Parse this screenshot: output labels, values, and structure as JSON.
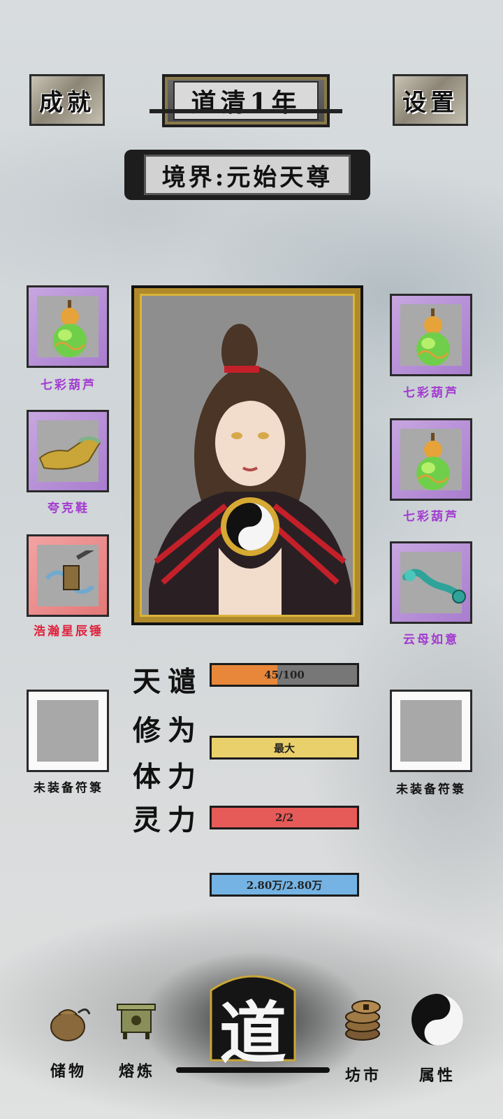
{
  "header": {
    "achievement_label": "成就",
    "settings_label": "设置",
    "year_title": "道清1年",
    "realm_label": "境界:元始天尊"
  },
  "equipment_left": [
    {
      "name": "七彩葫芦",
      "rarity_color": "#a23ad0"
    },
    {
      "name": "夸克鞋",
      "rarity_color": "#a23ad0"
    },
    {
      "name": "浩瀚星辰锤",
      "rarity_color": "#e0213b"
    }
  ],
  "equipment_right": [
    {
      "name": "七彩葫芦",
      "rarity_color": "#a23ad0"
    },
    {
      "name": "七彩葫芦",
      "rarity_color": "#a23ad0"
    },
    {
      "name": "云母如意",
      "rarity_color": "#a23ad0"
    }
  ],
  "talisman_slots": {
    "left": "未装备符箓",
    "right": "未装备符箓"
  },
  "stats": [
    {
      "label": "天谴",
      "value_text": "45/100",
      "fill": 0.45,
      "color": "#e8873a"
    },
    {
      "label": "修为",
      "value_text": "最大",
      "fill": 1.0,
      "color": "#e9d06a"
    },
    {
      "label": "体力",
      "value_text": "2/2",
      "fill": 1.0,
      "color": "#e65a57"
    },
    {
      "label": "灵力",
      "value_text": "2.80万/2.80万",
      "fill": 1.0,
      "color": "#74b3e3"
    }
  ],
  "bottom_nav": {
    "storage": "储物",
    "refine": "熔炼",
    "center": "道",
    "market": "坊市",
    "attributes": "属性"
  },
  "icons": {
    "gourd": "gourd-icon",
    "shoe": "shoe-icon",
    "hammer": "hammer-icon",
    "ruyi": "ruyi-icon",
    "bag": "bag-icon",
    "furnace": "furnace-icon",
    "coins": "coins-icon",
    "yinyang": "yinyang-icon"
  }
}
